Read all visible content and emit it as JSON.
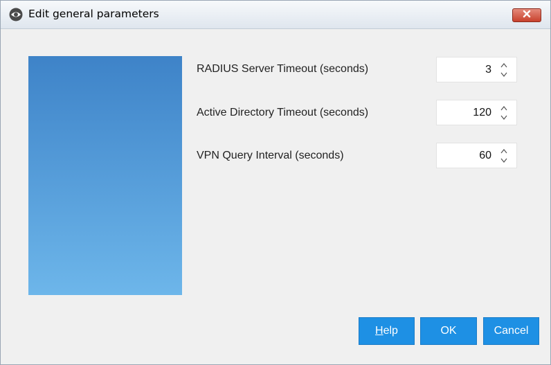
{
  "window": {
    "title": "Edit general parameters",
    "app_icon": "eye-icon",
    "close_icon": "close-icon"
  },
  "fields": [
    {
      "label": "RADIUS Server Timeout (seconds)",
      "value": "3"
    },
    {
      "label": "Active Directory Timeout (seconds)",
      "value": "120"
    },
    {
      "label": "VPN Query Interval (seconds)",
      "value": "60"
    }
  ],
  "buttons": {
    "help_first": "H",
    "help_rest": "elp",
    "ok": "OK",
    "cancel": "Cancel"
  },
  "colors": {
    "button": "#1e90e4",
    "panel_top": "#3e83c8",
    "panel_bottom": "#6db6ea",
    "close": "#c8412d"
  }
}
